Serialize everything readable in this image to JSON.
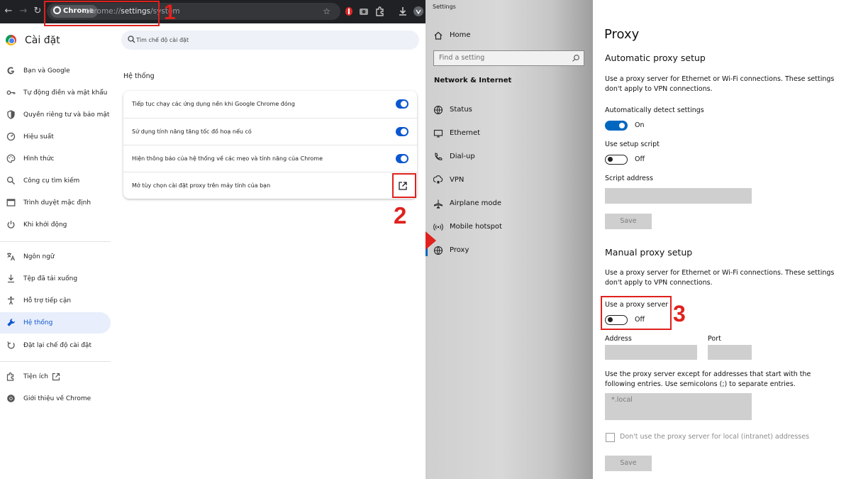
{
  "chrome": {
    "chip_label": "Chrome",
    "url_prefix": "chrome://",
    "url_path": "settings",
    "url_suffix": "/system",
    "brand_title": "Cài đặt",
    "search_placeholder": "Tìm chế độ cài đặt",
    "nav": [
      {
        "label": "Bạn và Google",
        "icon": "google-g-icon"
      },
      {
        "label": "Tự động điền và mật khẩu",
        "icon": "key-icon"
      },
      {
        "label": "Quyền riêng tư và bảo mật",
        "icon": "shield-icon"
      },
      {
        "label": "Hiệu suất",
        "icon": "speedometer-icon"
      },
      {
        "label": "Hình thức",
        "icon": "palette-icon"
      },
      {
        "label": "Công cụ tìm kiếm",
        "icon": "search-icon"
      },
      {
        "label": "Trình duyệt mặc định",
        "icon": "browser-window-icon"
      },
      {
        "label": "Khi khởi động",
        "icon": "power-icon"
      },
      {
        "label": "Ngôn ngữ",
        "icon": "translate-icon"
      },
      {
        "label": "Tệp đã tải xuống",
        "icon": "download-icon"
      },
      {
        "label": "Hỗ trợ tiếp cận",
        "icon": "accessibility-icon"
      },
      {
        "label": "Hệ thống",
        "icon": "wrench-icon",
        "active": true
      },
      {
        "label": "Đặt lại chế độ cài đặt",
        "icon": "reset-icon"
      },
      {
        "label": "Tiện ích",
        "icon": "puzzle-icon"
      },
      {
        "label": "Giới thiệu về Chrome",
        "icon": "chrome-icon"
      }
    ],
    "section_title": "Hệ thống",
    "rows": [
      {
        "label": "Tiếp tục chạy các ứng dụng nền khi Google Chrome đóng",
        "toggle": true
      },
      {
        "label": "Sử dụng tính năng tăng tốc đồ hoạ nếu có",
        "toggle": true
      },
      {
        "label": "Hiện thông báo của hệ thống về các mẹo và tính năng của Chrome",
        "toggle": true
      },
      {
        "label": "Mở tùy chọn cài đặt proxy trên máy tính của bạn",
        "toggle": false
      }
    ],
    "accent": "#0b57d0"
  },
  "annotations": {
    "step1": "1",
    "step2": "2",
    "step3": "3",
    "color": "#e0211d"
  },
  "windows": {
    "window_title": "Settings",
    "home_label": "Home",
    "find_placeholder": "Find a setting",
    "section": "Network & Internet",
    "nav": [
      {
        "label": "Status",
        "icon": "globe-icon"
      },
      {
        "label": "Ethernet",
        "icon": "ethernet-icon"
      },
      {
        "label": "Dial-up",
        "icon": "phone-icon"
      },
      {
        "label": "VPN",
        "icon": "vpn-icon"
      },
      {
        "label": "Airplane mode",
        "icon": "airplane-icon"
      },
      {
        "label": "Mobile hotspot",
        "icon": "hotspot-icon"
      },
      {
        "label": "Proxy",
        "icon": "globe-icon",
        "active": true
      }
    ],
    "page_title": "Proxy",
    "auto_title": "Automatic proxy setup",
    "auto_desc": "Use a proxy server for Ethernet or Wi-Fi connections. These settings don't apply to VPN connections.",
    "auto_detect_label": "Automatically detect settings",
    "auto_detect_state": "On",
    "setup_script_label": "Use setup script",
    "setup_script_state": "Off",
    "script_address_label": "Script address",
    "save_label": "Save",
    "manual_title": "Manual proxy setup",
    "manual_desc": "Use a proxy server for Ethernet or Wi-Fi connections. These settings don't apply to VPN connections.",
    "use_proxy_label": "Use a proxy server",
    "use_proxy_state": "Off",
    "address_label": "Address",
    "port_label": "Port",
    "exceptions_desc": "Use the proxy server except for addresses that start with the following entries. Use semicolons (;) to separate entries.",
    "exceptions_value": "*.local",
    "local_bypass_label": "Don't use the proxy server for local (intranet) addresses",
    "save2_label": "Save",
    "accent": "#0067c0"
  }
}
